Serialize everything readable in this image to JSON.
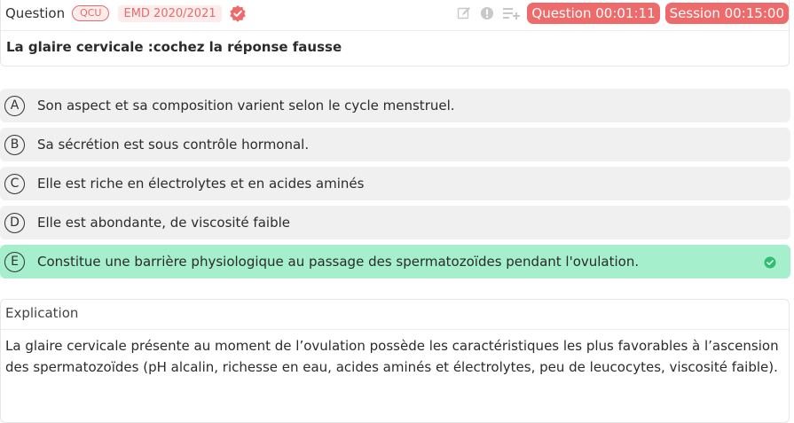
{
  "header": {
    "title": "Question",
    "type_badge": "QCU",
    "source_badge": "EMD 2020/2021",
    "question_timer": "Question 00:01:11",
    "session_timer": "Session 00:15:00",
    "icons": [
      "edit-icon",
      "info-icon",
      "playlist-add-icon",
      "verified-icon"
    ],
    "colors": {
      "accent": "#ef6b6b",
      "correct": "#a5efcc",
      "option_bg": "#f0f0f1"
    }
  },
  "question": {
    "text": "La glaire cervicale :cochez la réponse fausse"
  },
  "options": [
    {
      "letter": "A",
      "text": "Son aspect et sa composition varient selon le cycle menstruel."
    },
    {
      "letter": "B",
      "text": "Sa sécrétion est sous contrôle hormonal."
    },
    {
      "letter": "C",
      "text": "Elle est riche en électrolytes et en acides aminés"
    },
    {
      "letter": "D",
      "text": "Elle est abondante, de viscosité faible"
    },
    {
      "letter": "E",
      "text": "Constitue une barrière physiologique au passage des spermatozoïdes pendant l'ovulation."
    }
  ],
  "explanation": {
    "title": "Explication",
    "text": "La glaire cervicale présente au moment de l’ovulation possède les caractéristiques les plus favorables à l’ascension des spermatozoïdes (pH alcalin, richesse en eau, acides aminés et électrolytes, peu de leucocytes, viscosité faible)."
  }
}
